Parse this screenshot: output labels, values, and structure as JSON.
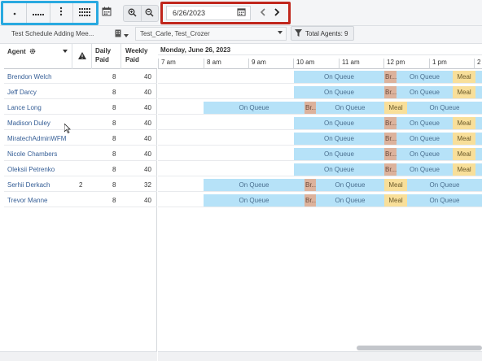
{
  "toolbar": {
    "view_buttons": [
      {
        "icon": "single-dot-icon"
      },
      {
        "icon": "dotted-line-icon"
      },
      {
        "icon": "vertical-dots-icon"
      },
      {
        "icon": "grid-icon"
      }
    ],
    "calendar_icon": "calendar-icon",
    "zoom_in_icon": "zoom-in-icon",
    "zoom_out_icon": "zoom-out-icon",
    "date_value": "6/26/2023",
    "prev_icon": "chevron-left-icon",
    "next_icon": "chevron-right-icon",
    "highlight_colors": {
      "view_group": "#29a9e0",
      "date_group": "#c0261c"
    }
  },
  "filters": {
    "schedule_name": "Test Schedule Adding Mee...",
    "team_select_value": "Test_Carle, Test_Crozer",
    "total_agents_label": "Total Agents: 9"
  },
  "grid": {
    "headers": {
      "agent": "Agent",
      "daily_paid": [
        "Daily",
        "Paid"
      ],
      "weekly_paid": [
        "Weekly",
        "Paid"
      ]
    },
    "date_label": "Monday, June 26, 2023",
    "hours": [
      "7 am",
      "8 am",
      "9 am",
      "10 am",
      "11 am",
      "12 pm",
      "1 pm",
      "2"
    ],
    "rows": [
      {
        "name": "Brendon Welch",
        "warnings": "",
        "daily": "8",
        "weekly": "40"
      },
      {
        "name": "Jeff Darcy",
        "warnings": "",
        "daily": "8",
        "weekly": "40"
      },
      {
        "name": "Lance Long",
        "warnings": "",
        "daily": "8",
        "weekly": "40"
      },
      {
        "name": "Madison Duley",
        "warnings": "",
        "daily": "8",
        "weekly": "40"
      },
      {
        "name": "MiratechAdminWFM",
        "warnings": "",
        "daily": "8",
        "weekly": "40"
      },
      {
        "name": "Nicole Chambers",
        "warnings": "",
        "daily": "8",
        "weekly": "40"
      },
      {
        "name": "Oleksii Petrenko",
        "warnings": "",
        "daily": "8",
        "weekly": "40"
      },
      {
        "name": "Serhii Derkach",
        "warnings": "2",
        "daily": "8",
        "weekly": "32"
      },
      {
        "name": "Trevor Manne",
        "warnings": "",
        "daily": "8",
        "weekly": "40"
      }
    ],
    "activity_labels": {
      "queue": "On Queue",
      "break": "Br...",
      "meal": "Meal"
    },
    "activity_colors": {
      "queue": "#b6e2f8",
      "break": "#dcb29c",
      "meal": "#f8df9a"
    }
  }
}
